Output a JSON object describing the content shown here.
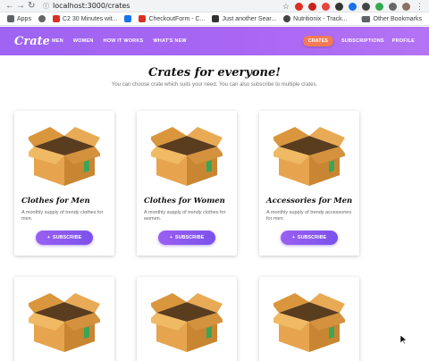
{
  "browser": {
    "url": "localhost:3000/crates",
    "bookmarks": [
      {
        "label": "Apps",
        "color": "#5f6368"
      },
      {
        "label": "",
        "color": "#666666"
      },
      {
        "label": "C2 30 Minutes wit...",
        "color": "#d93025"
      },
      {
        "label": "",
        "color": "#1a73e8"
      },
      {
        "label": "CheckoutForm - C...",
        "color": "#d93025"
      },
      {
        "label": "Just another Sear...",
        "color": "#333333"
      },
      {
        "label": "Nutritionix - Track...",
        "color": "#444444"
      }
    ],
    "other_bookmarks": "Other Bookmarks"
  },
  "navbar": {
    "brand": "Crate",
    "links": [
      "MEN",
      "WOMEN",
      "HOW IT WORKS",
      "WHAT'S NEW"
    ],
    "right": {
      "active": "CRATES",
      "subscriptions": "SUBSCRIPTIONS",
      "profile": "PROFILE"
    }
  },
  "hero": {
    "title": "Crates for everyone!",
    "subtitle": "You can choose crate which suits your need. You can also subscribe to multiple crates."
  },
  "cards": [
    {
      "title": "Clothes for Men",
      "description": "A monthly supply of trendy clothes for men.",
      "button": "SUBSCRIBE"
    },
    {
      "title": "Clothes for Women",
      "description": "A monthly supply of trendy clothes for women.",
      "button": "SUBSCRIBE"
    },
    {
      "title": "Accessories for Men",
      "description": "A monthly supply of trendy accessories for men",
      "button": "SUBSCRIBE"
    }
  ],
  "colors": {
    "navbar_start": "#9f64f2",
    "navbar_end": "#b473f5",
    "accent_pill": "#f37a56",
    "button": "#8a58ef"
  }
}
